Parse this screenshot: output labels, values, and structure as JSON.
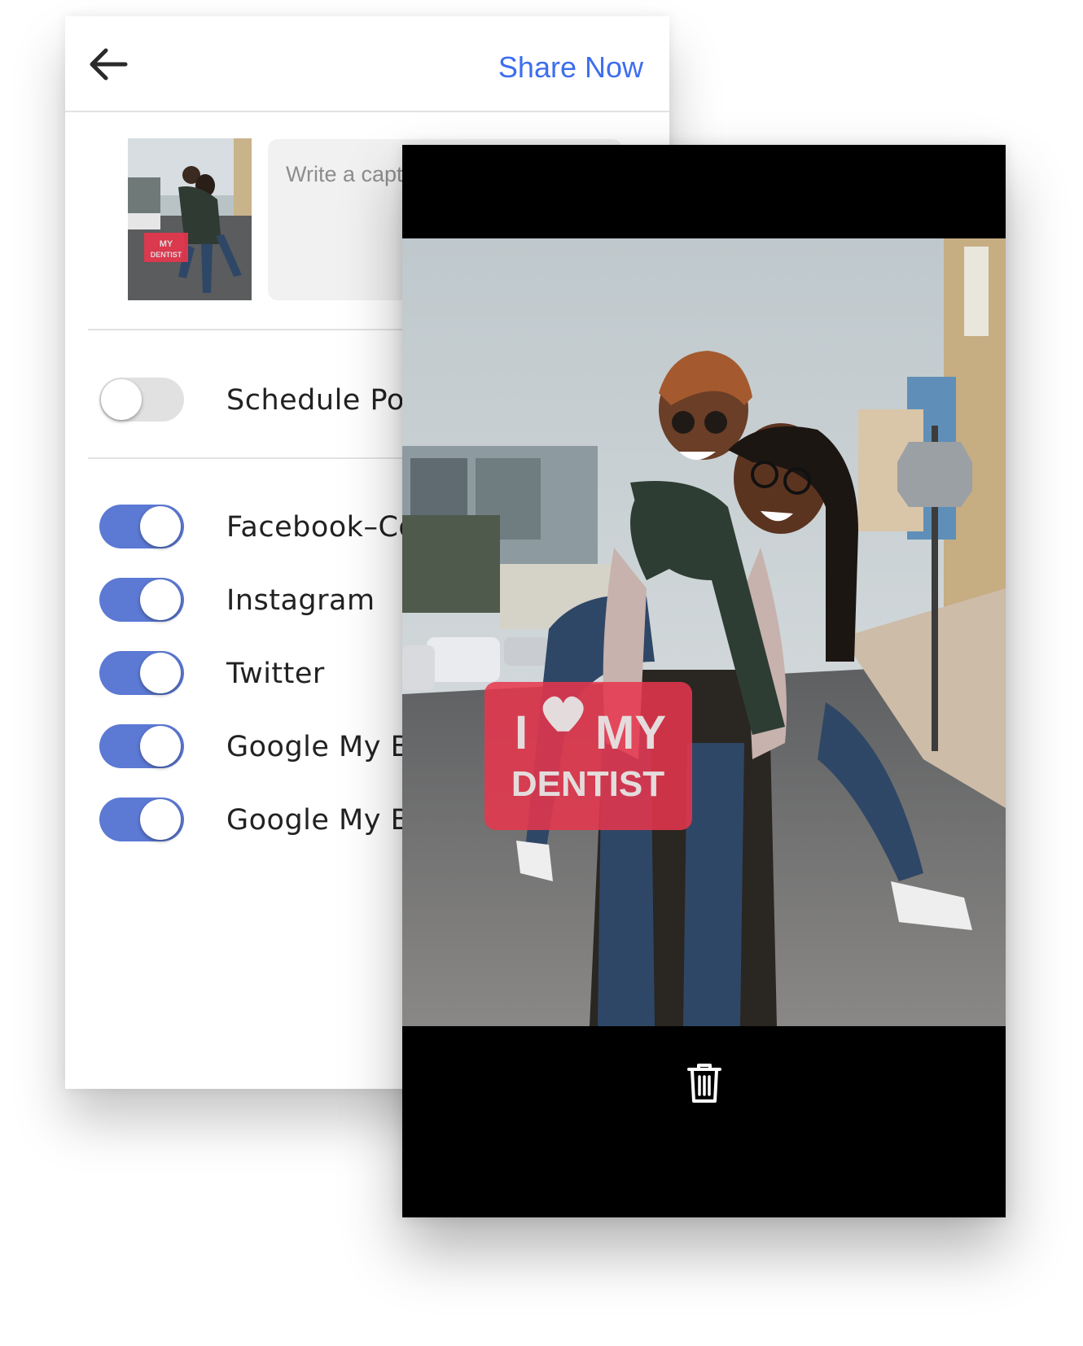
{
  "header": {
    "share_label": "Share Now"
  },
  "composer": {
    "caption_placeholder": "Write a capt"
  },
  "schedule": {
    "label": "Schedule Post",
    "enabled": false
  },
  "accounts": [
    {
      "label": "Facebook–Coa",
      "enabled": true
    },
    {
      "label": "Instagram",
      "enabled": true
    },
    {
      "label": "Twitter",
      "enabled": true
    },
    {
      "label": "Google My Bus",
      "enabled": true
    },
    {
      "label": "Google My Bus",
      "enabled": true
    }
  ],
  "badge": {
    "line1_left": "I",
    "line1_right": "MY",
    "line2": "DENTIST"
  },
  "colors": {
    "accent": "#3d6ef0",
    "toggle_on": "#5c79d4",
    "badge_red": "#e8354d"
  },
  "icons": [
    "arrow-left-icon",
    "trash-icon",
    "heart-icon"
  ]
}
